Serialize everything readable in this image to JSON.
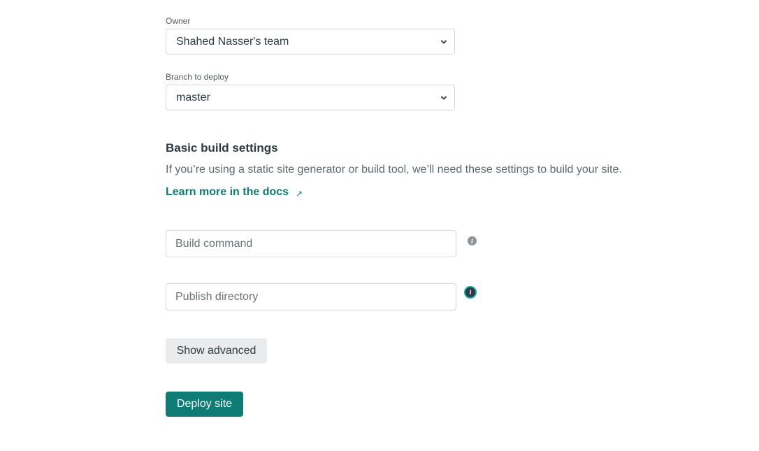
{
  "owner": {
    "label": "Owner",
    "selected": "Shahed Nasser's team"
  },
  "branch": {
    "label": "Branch to deploy",
    "selected": "master"
  },
  "build_settings": {
    "heading": "Basic build settings",
    "description": "If you’re using a static site generator or build tool, we’ll need these settings to build your site.",
    "docs_link": "Learn more in the docs",
    "docs_link_icon": "external-arrow-icon"
  },
  "build_command": {
    "placeholder": "Build command",
    "value": "",
    "info_icon": "info-icon"
  },
  "publish_directory": {
    "placeholder": "Publish directory",
    "value": "",
    "info_icon": "info-icon"
  },
  "buttons": {
    "show_advanced": "Show advanced",
    "deploy": "Deploy site"
  },
  "colors": {
    "accent": "#0e7c74",
    "focus_ring": "#15a5a0",
    "secondary_button": "#e9ebed"
  }
}
